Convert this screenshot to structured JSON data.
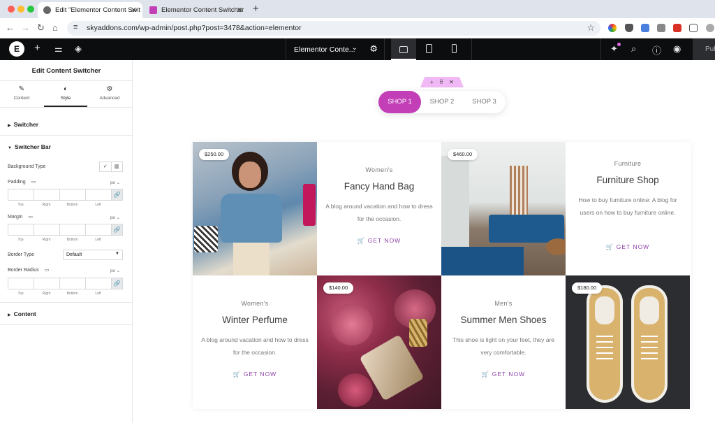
{
  "browser": {
    "tabs": [
      {
        "title": "Edit \"Elementor Content Swit",
        "active": true
      },
      {
        "title": "Elementor Content Switcher",
        "active": false
      }
    ],
    "url": "skyaddons.com/wp-admin/post.php?post=3478&action=elementor"
  },
  "editor": {
    "document_title": "Elementor Conte...",
    "publish_label": "Publish"
  },
  "panel": {
    "title": "Edit Content Switcher",
    "tabs": [
      {
        "label": "Content",
        "icon": "pencil-icon"
      },
      {
        "label": "Style",
        "icon": "half-circle-icon"
      },
      {
        "label": "Advanced",
        "icon": "gear-icon"
      }
    ],
    "sections": {
      "switcher": "Switcher",
      "switcher_bar": "Switcher Bar",
      "content": "Content"
    },
    "controls": {
      "background_type": "Background Type",
      "padding": "Padding",
      "margin": "Margin",
      "border_type": "Border Type",
      "border_type_value": "Default",
      "border_radius": "Border Radius",
      "unit": "px",
      "dims": [
        "Top",
        "Right",
        "Bottom",
        "Left"
      ]
    }
  },
  "switcher": {
    "items": [
      "SHOP 1",
      "SHOP 2",
      "SHOP 3"
    ],
    "active_index": 0,
    "accent": "#c23fb8"
  },
  "products": {
    "get_now": "GET NOW",
    "cards": [
      {
        "price": "$250.00",
        "category": "Women's",
        "title": "Fancy Hand Bag",
        "description": "A blog around vacation and how to dress for the occasion."
      },
      {
        "price": "$460.00",
        "category": "Furniture",
        "title": "Furniture Shop",
        "description": "How to buy furniture online: A blog for users on how to buy furniture online."
      },
      {
        "price": "$140.00",
        "category": "Women's",
        "title": "Winter Perfume",
        "description": "A blog around vacation and how to dress for the occasion."
      },
      {
        "price": "$180.00",
        "category": "Men's",
        "title": "Summer Men Shoes",
        "description": "This shoe is light on your feet, they are very comfortable."
      }
    ]
  }
}
